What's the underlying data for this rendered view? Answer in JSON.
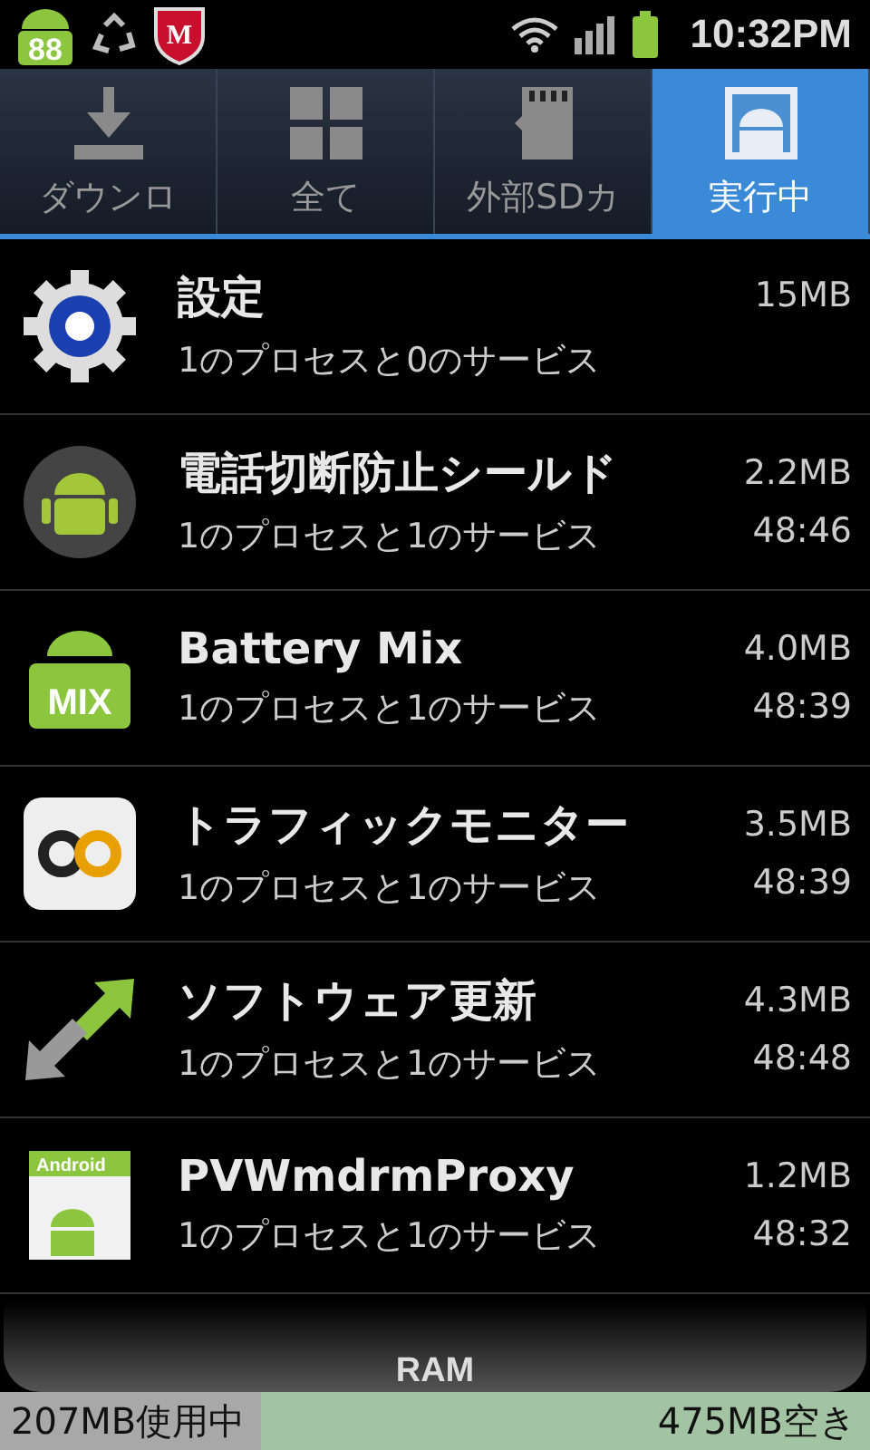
{
  "status_bar": {
    "notifications": [
      {
        "kind": "android",
        "badge": "88"
      },
      {
        "kind": "recycle"
      },
      {
        "kind": "shield",
        "badge": "M"
      }
    ],
    "time": "10:32PM"
  },
  "tabs": [
    {
      "label": "ダウンロ",
      "kind": "download",
      "selected": false
    },
    {
      "label": "全て",
      "kind": "grid",
      "selected": false
    },
    {
      "label": "外部SDカ",
      "kind": "sdcard",
      "selected": false
    },
    {
      "label": "実行中",
      "kind": "running",
      "selected": true
    }
  ],
  "apps": [
    {
      "kind": "gear",
      "name": "設定",
      "detail": "1のプロセスと0のサービス",
      "size": "15MB"
    },
    {
      "kind": "android-circle",
      "name": "電話切断防止シールド",
      "detail": "1のプロセスと1のサービス",
      "size": "2.2MB",
      "time": "48:46"
    },
    {
      "kind": "battery",
      "icon_text": "MIX",
      "name": "Battery Mix",
      "detail": "1のプロセスと1のサービス",
      "size": "4.0MB",
      "time": "48:39"
    },
    {
      "kind": "infinity",
      "name": "トラフィックモニター",
      "detail": "1のプロセスと1のサービス",
      "size": "3.5MB",
      "time": "48:39"
    },
    {
      "kind": "arrows",
      "name": "ソフトウェア更新",
      "detail": "1のプロセスと1のサービス",
      "size": "4.3MB",
      "time": "48:48"
    },
    {
      "kind": "android-card",
      "icon_text": "Android",
      "name": "PVWmdrmProxy",
      "detail": "1のプロセスと1のサービス",
      "size": "1.2MB",
      "time": "48:32"
    }
  ],
  "ram": {
    "label": "RAM",
    "used": "207MB使用中",
    "free": "475MB空き",
    "level": 0.3
  }
}
